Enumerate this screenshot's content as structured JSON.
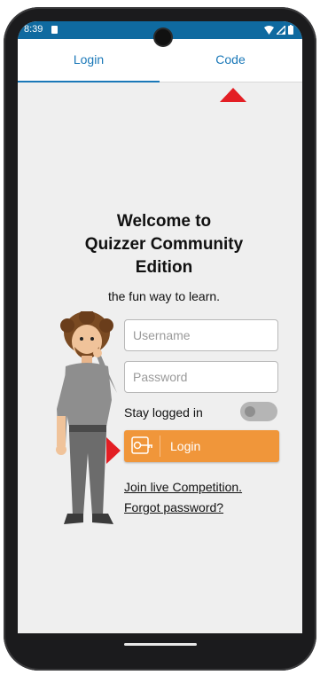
{
  "status_bar": {
    "time": "8:39"
  },
  "tabs": [
    {
      "label": "Login"
    },
    {
      "label": "Code"
    }
  ],
  "welcome": {
    "line1": "Welcome to",
    "line2": "Quizzer Community",
    "line3": "Edition",
    "subtitle": "the fun way to learn."
  },
  "form": {
    "username_placeholder": "Username",
    "password_placeholder": "Password",
    "stay_logged_in_label": "Stay logged in",
    "stay_logged_in": false,
    "login_label": "Login"
  },
  "links": {
    "join_live": "Join live Competition.",
    "forgot_password": "Forgot password?"
  },
  "colors": {
    "status_bar": "#0f6aa0",
    "tab_accent": "#1a78b8",
    "login_button": "#f0963a",
    "marker": "#e31e24",
    "screen_bg": "#efefef"
  },
  "icons": [
    "sd-card-icon",
    "wifi-icon",
    "signal-icon",
    "battery-icon",
    "key-icon",
    "character-avatar"
  ]
}
